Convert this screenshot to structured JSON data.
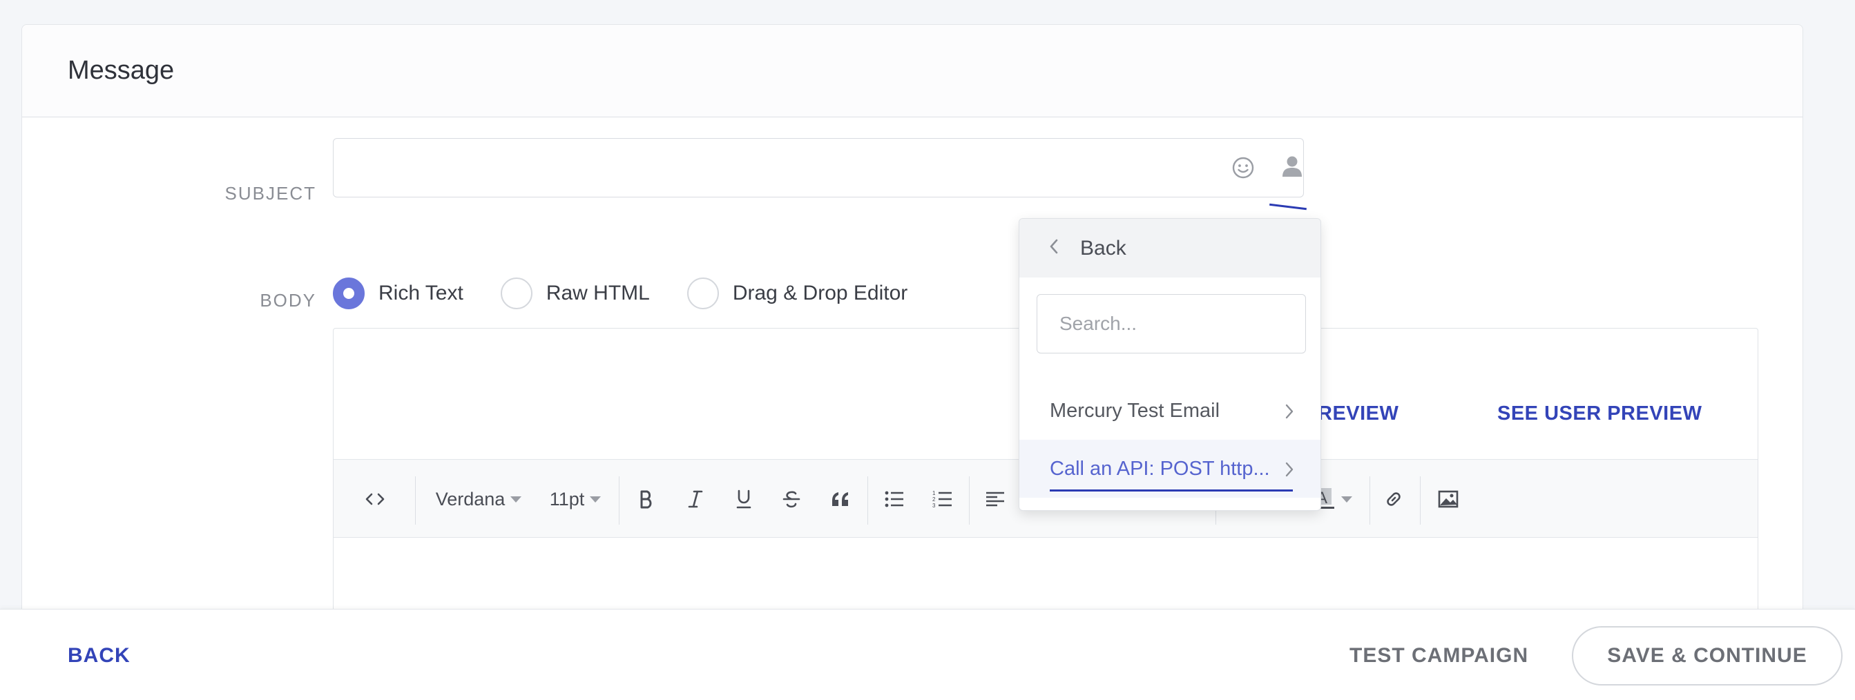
{
  "card": {
    "title": "Message"
  },
  "subject": {
    "label": "SUBJECT",
    "value": ""
  },
  "body": {
    "label": "BODY",
    "options": [
      {
        "label": "Rich Text",
        "checked": true
      },
      {
        "label": "Raw HTML",
        "checked": false
      },
      {
        "label": "Drag & Drop Editor",
        "checked": false
      }
    ]
  },
  "editor": {
    "preview_partial": "REVIEW",
    "see_user_preview": "SEE USER PREVIEW",
    "toolbar": {
      "font": "Verdana",
      "size": "11pt",
      "icons": [
        "code-icon",
        "bold-icon",
        "italic-icon",
        "underline-icon",
        "strikethrough-icon",
        "blockquote-icon",
        "bulleted-list-icon",
        "numbered-list-icon",
        "align-left-icon",
        "align-center-icon",
        "align-right-icon",
        "justify-icon",
        "indent-icon",
        "text-color-icon",
        "background-color-icon",
        "link-icon",
        "image-icon"
      ]
    }
  },
  "dropdown": {
    "back_label": "Back",
    "search_placeholder": "Search...",
    "items": [
      {
        "label": "Mercury Test Email",
        "active": false
      },
      {
        "label": "Call an API: POST http...",
        "active": true
      }
    ]
  },
  "footer": {
    "back_label": "BACK",
    "test_label": "TEST CAMPAIGN",
    "save_label": "SAVE & CONTINUE"
  },
  "colors": {
    "accent": "#3344b8",
    "radio_checked": "#6a76db",
    "active_item_text": "#5664cf"
  }
}
